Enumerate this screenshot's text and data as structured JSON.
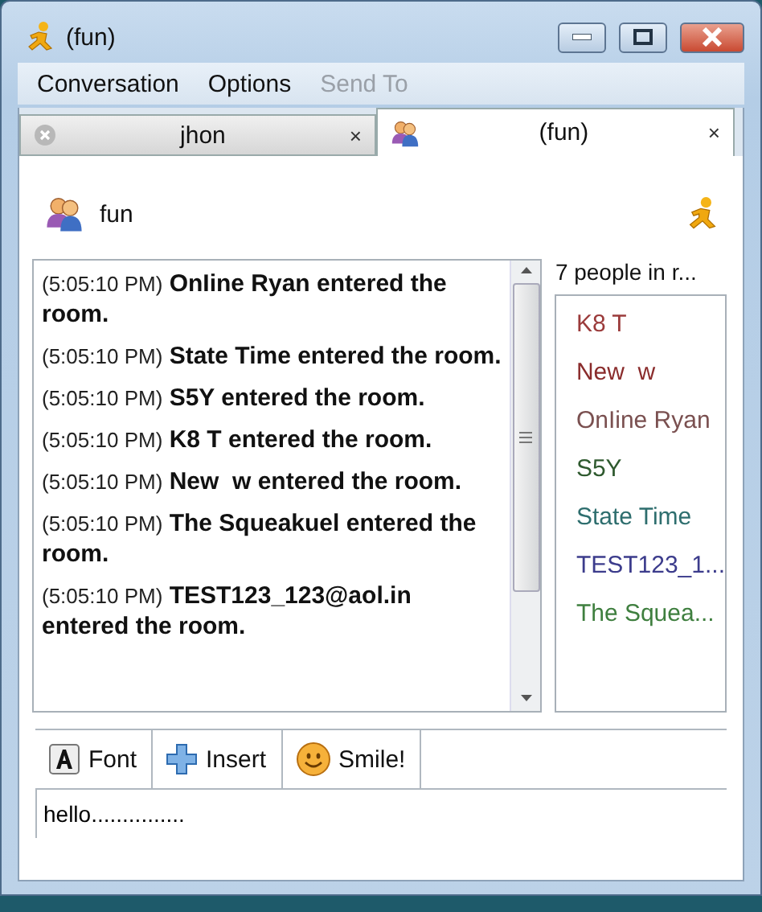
{
  "window": {
    "title": "(fun)"
  },
  "menu": [
    {
      "label": "Conversation",
      "disabled": false
    },
    {
      "label": "Options",
      "disabled": false
    },
    {
      "label": "Send To",
      "disabled": true
    }
  ],
  "tabs": [
    {
      "label": "jhon",
      "selected": false,
      "kind": "person",
      "close": "×"
    },
    {
      "label": "(fun)",
      "selected": true,
      "kind": "group",
      "close": "×"
    }
  ],
  "room": {
    "name": "fun"
  },
  "messages": [
    {
      "time": "(5:05:10 PM)",
      "text": "OnIine Ryan entered the room."
    },
    {
      "time": "(5:05:10 PM)",
      "text": "State Time entered the room."
    },
    {
      "time": "(5:05:10 PM)",
      "text": "S5Y entered the room."
    },
    {
      "time": "(5:05:10 PM)",
      "text": "K8 T entered the room."
    },
    {
      "time": "(5:05:10 PM)",
      "text": "New  w entered the room."
    },
    {
      "time": "(5:05:10 PM)",
      "text": "The Squeakuel entered the room."
    },
    {
      "time": "(5:05:10 PM)",
      "text": "TEST123_123@aol.in entered the room."
    }
  ],
  "people": {
    "label": "7 people in r...",
    "members": [
      {
        "name": "K8 T",
        "color": "#9b3b3b"
      },
      {
        "name": "New  w",
        "color": "#8a2c2c"
      },
      {
        "name": "OnIine Ryan",
        "color": "#7a5050"
      },
      {
        "name": "S5Y",
        "color": "#2f5a2f"
      },
      {
        "name": "State Time",
        "color": "#2e6e6e"
      },
      {
        "name": "TEST123_1...",
        "color": "#3c3c8c"
      },
      {
        "name": "The Squea...",
        "color": "#3f7f3f"
      }
    ]
  },
  "toolbar": [
    {
      "label": "Font",
      "kind": "font"
    },
    {
      "label": "Insert",
      "kind": "insert"
    },
    {
      "label": "Smile!",
      "kind": "smile"
    }
  ],
  "input": {
    "value": "hello..............."
  }
}
